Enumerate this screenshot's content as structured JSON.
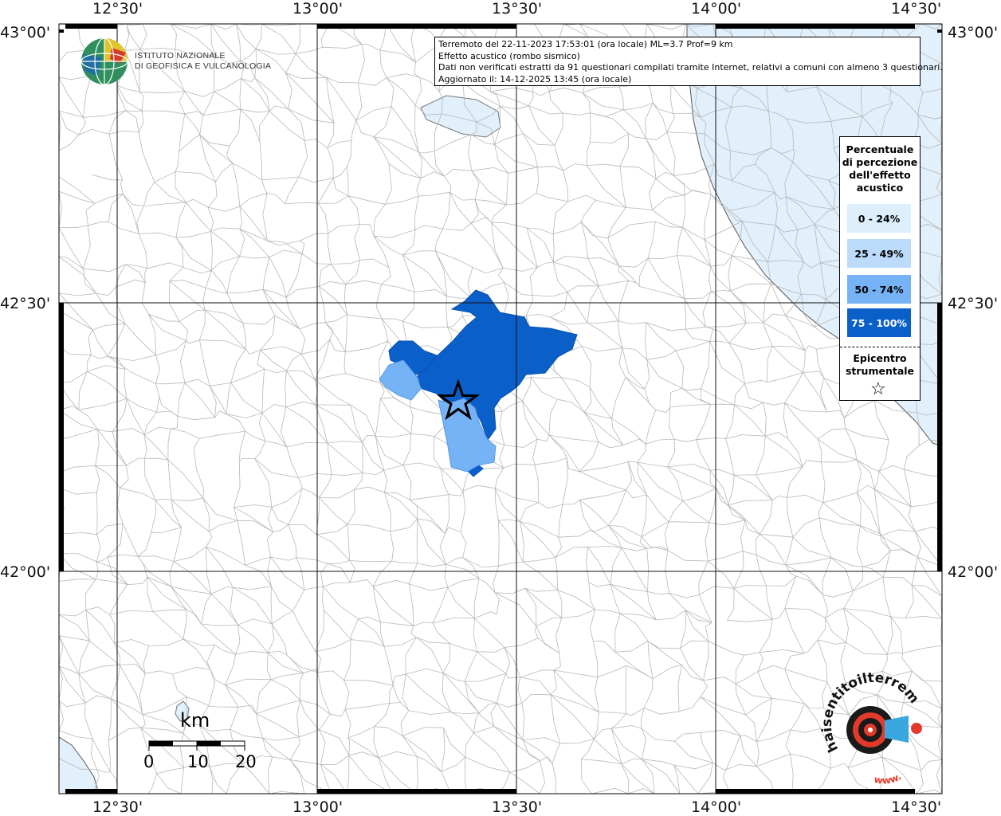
{
  "info": {
    "line1": "Terremoto del 22-11-2023 17:53:01 (ora locale) ML=3.7 Prof=9 km",
    "line2": "Effetto acustico (rombo sismico)",
    "line3": "Dati non verificati estratti da 91 questionari compilati tramite Internet, relativi a comuni con almeno 3 questionari.",
    "line4": "Aggiornato il: 14-12-2025 13:45 (ora locale)"
  },
  "ticks": {
    "lon": [
      "12°30'",
      "13°00'",
      "13°30'",
      "14°00'",
      "14°30'"
    ],
    "lat": [
      "43°00'",
      "42°30'",
      "42°00'"
    ]
  },
  "logo": {
    "line1": "ISTITUTO NAZIONALE",
    "line2": "DI GEOFISICA E VULCANOLOGIA"
  },
  "legend": {
    "title": "Percentuale di percezione dell'effetto acustico",
    "items": [
      {
        "label": "0 - 24%",
        "color": "#ddeefd"
      },
      {
        "label": "25 - 49%",
        "color": "#bcdafa"
      },
      {
        "label": "50 - 74%",
        "color": "#75b2f6"
      },
      {
        "label": "75 - 100%",
        "color": "#0a5fc9"
      }
    ],
    "epicenter_label": "Epicentro strumentale",
    "epicenter_symbol": "☆"
  },
  "scale": {
    "unit": "km",
    "labels": [
      "0",
      "10",
      "20"
    ]
  },
  "badge": {
    "text": "haisentitoilterremoto.it",
    "www": "www."
  },
  "colors": {
    "sea": "#e1f0fb",
    "boundary": "#b8b8b8"
  }
}
